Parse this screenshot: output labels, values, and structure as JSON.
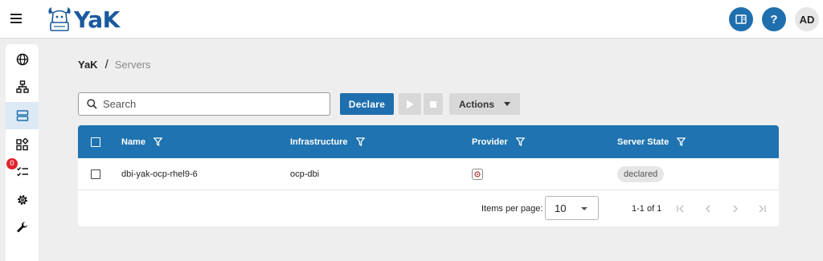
{
  "app": {
    "name": "YaK"
  },
  "header": {
    "avatar_initials": "AD",
    "help_label": "?"
  },
  "sidebar": {
    "notification_count": "0"
  },
  "breadcrumb": {
    "home": "YaK",
    "separator": "/",
    "current": "Servers"
  },
  "toolbar": {
    "search_placeholder": "Search",
    "declare_label": "Declare",
    "actions_label": "Actions"
  },
  "table": {
    "columns": [
      "Name",
      "Infrastructure",
      "Provider",
      "Server State"
    ],
    "rows": [
      {
        "name": "dbi-yak-ocp-rhel9-6",
        "infrastructure": "ocp-dbi",
        "provider_icon": "provider-icon",
        "state": "declared"
      }
    ]
  },
  "paginator": {
    "items_per_page_label": "Items per page:",
    "page_size": "10",
    "range_label": "1-1 of 1"
  },
  "colors": {
    "primary": "#1f73b0",
    "badge": "#e0242c",
    "background": "#eeeeee"
  }
}
